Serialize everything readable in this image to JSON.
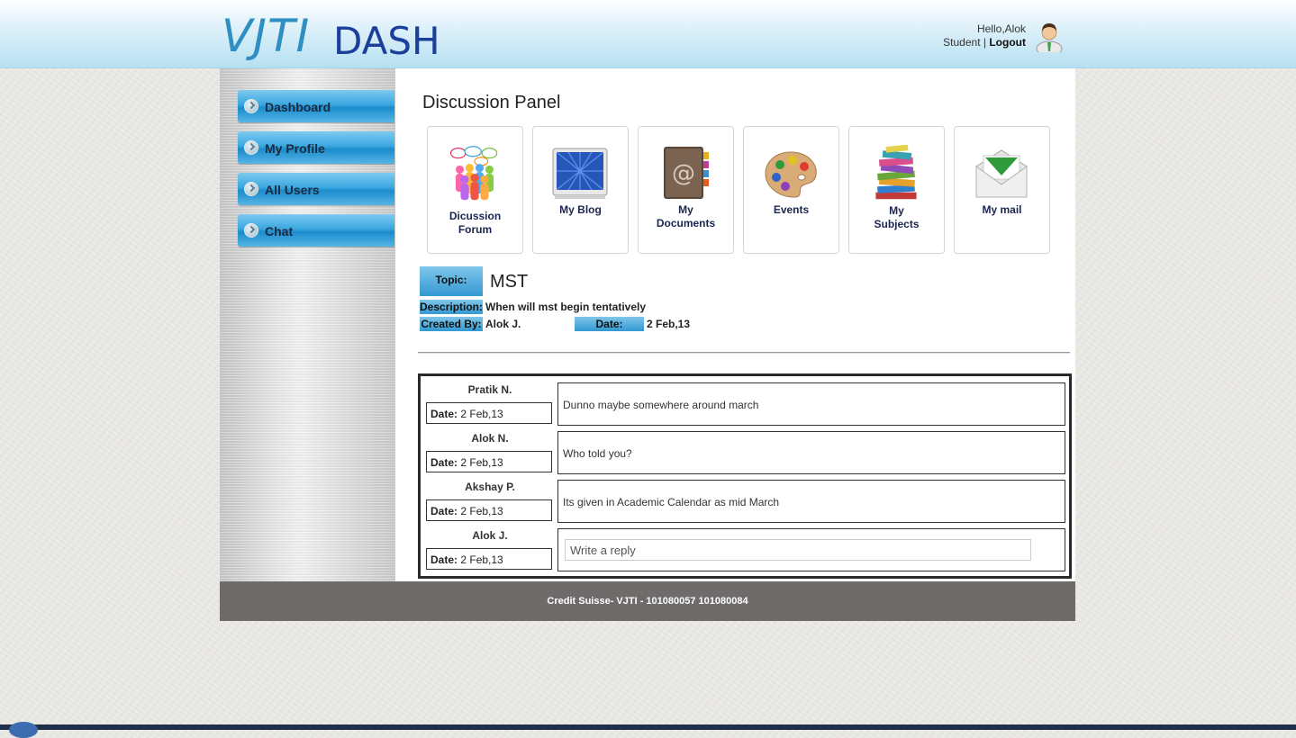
{
  "header": {
    "logo_vjti": "VJTI",
    "logo_dash": "DASH",
    "greeting": "Hello,Alok",
    "role": "Student",
    "separator": "|",
    "logout": "Logout"
  },
  "sidebar": {
    "items": [
      {
        "label": "Dashboard"
      },
      {
        "label": "My Profile"
      },
      {
        "label": "All Users"
      },
      {
        "label": "Chat"
      }
    ]
  },
  "main": {
    "title": "Discussion Panel",
    "tiles": [
      {
        "line1": "Dicussion",
        "line2": "Forum",
        "icon": "discussion-forum-icon"
      },
      {
        "line1": "My Blog",
        "line2": "",
        "icon": "blog-icon"
      },
      {
        "line1": "My",
        "line2": "Documents",
        "icon": "address-book-icon"
      },
      {
        "line1": "Events",
        "line2": "",
        "icon": "palette-icon"
      },
      {
        "line1": "My",
        "line2": "Subjects",
        "icon": "books-icon"
      },
      {
        "line1": "My mail",
        "line2": "",
        "icon": "envelope-icon"
      }
    ],
    "topic": {
      "topic_label": "Topic:",
      "topic_value": "MST",
      "description_label": "Description:",
      "description_value": "When will mst begin tentatively",
      "created_by_label": "Created By:",
      "created_by_value": "Alok J.",
      "date_label": "Date:",
      "date_value": "2 Feb,13"
    },
    "replies": [
      {
        "author": "Pratik N.",
        "date_label": "Date:",
        "date": "2 Feb,13",
        "message": "Dunno maybe somewhere around march"
      },
      {
        "author": "Alok N.",
        "date_label": "Date:",
        "date": "2 Feb,13",
        "message": "Who told you?"
      },
      {
        "author": "Akshay P.",
        "date_label": "Date:",
        "date": "2 Feb,13",
        "message": "Its given in Academic Calendar as mid March"
      },
      {
        "author": "Alok J.",
        "date_label": "Date:",
        "date": "2 Feb,13",
        "reply_placeholder": "Write a reply",
        "reply_value": ""
      }
    ]
  },
  "footer": {
    "text": "Credit Suisse- VJTI - 101080057 101080084"
  },
  "colors": {
    "accent_blue": "#3aa7e0",
    "logo_blue": "#2f8ec2",
    "footer_gray": "#6e6b6a"
  }
}
